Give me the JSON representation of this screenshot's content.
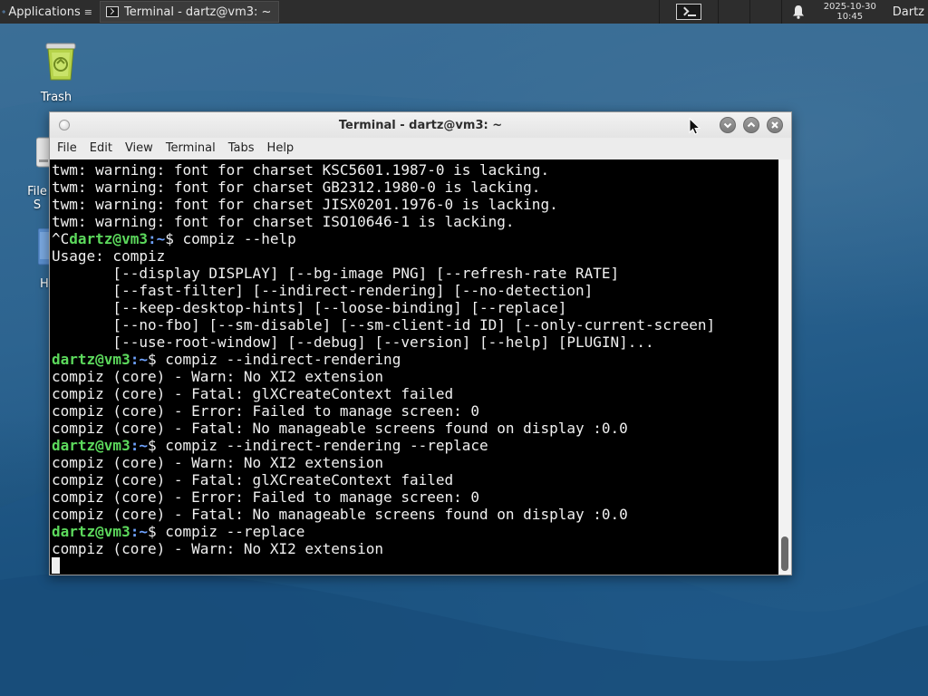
{
  "panel": {
    "applications_label": "Applications",
    "task_label": "Terminal - dartz@vm3: ~",
    "clock_date": "2025-10-30",
    "clock_time": "10:45",
    "user": "Dartz"
  },
  "desktop": {
    "trash_label": "Trash",
    "file_label": "File S",
    "home_label": "H"
  },
  "window": {
    "title": "Terminal - dartz@vm3: ~",
    "menu": [
      "File",
      "Edit",
      "View",
      "Terminal",
      "Tabs",
      "Help"
    ]
  },
  "terminal": {
    "prompt_user": "dartz@vm3",
    "prompt_path": ":~",
    "prompt_symbol": "$ ",
    "lines": [
      {
        "type": "out",
        "text": "twm: warning: font for charset KSC5601.1987-0 is lacking."
      },
      {
        "type": "out",
        "text": "twm: warning: font for charset GB2312.1980-0 is lacking."
      },
      {
        "type": "out",
        "text": "twm: warning: font for charset JISX0201.1976-0 is lacking."
      },
      {
        "type": "out",
        "text": "twm: warning: font for charset ISO10646-1 is lacking."
      },
      {
        "type": "cmd",
        "pre": "^C",
        "cmd": "compiz --help"
      },
      {
        "type": "out",
        "text": "Usage: compiz"
      },
      {
        "type": "out",
        "text": "       [--display DISPLAY] [--bg-image PNG] [--refresh-rate RATE]"
      },
      {
        "type": "out",
        "text": "       [--fast-filter] [--indirect-rendering] [--no-detection]"
      },
      {
        "type": "out",
        "text": "       [--keep-desktop-hints] [--loose-binding] [--replace]"
      },
      {
        "type": "out",
        "text": "       [--no-fbo] [--sm-disable] [--sm-client-id ID] [--only-current-screen]"
      },
      {
        "type": "out",
        "text": "       [--use-root-window] [--debug] [--version] [--help] [PLUGIN]..."
      },
      {
        "type": "cmd",
        "pre": "",
        "cmd": "compiz --indirect-rendering"
      },
      {
        "type": "out",
        "text": "compiz (core) - Warn: No XI2 extension"
      },
      {
        "type": "out",
        "text": "compiz (core) - Fatal: glXCreateContext failed"
      },
      {
        "type": "out",
        "text": "compiz (core) - Error: Failed to manage screen: 0"
      },
      {
        "type": "out",
        "text": "compiz (core) - Fatal: No manageable screens found on display :0.0"
      },
      {
        "type": "cmd",
        "pre": "",
        "cmd": "compiz --indirect-rendering --replace"
      },
      {
        "type": "out",
        "text": "compiz (core) - Warn: No XI2 extension"
      },
      {
        "type": "out",
        "text": "compiz (core) - Fatal: glXCreateContext failed"
      },
      {
        "type": "out",
        "text": "compiz (core) - Error: Failed to manage screen: 0"
      },
      {
        "type": "out",
        "text": "compiz (core) - Fatal: No manageable screens found on display :0.0"
      },
      {
        "type": "cmd",
        "pre": "",
        "cmd": "compiz --replace"
      },
      {
        "type": "out",
        "text": "compiz (core) - Warn: No XI2 extension"
      },
      {
        "type": "cursor"
      }
    ]
  },
  "colors": {
    "prompt_user": "#5cd95c",
    "prompt_path": "#6fa3ff",
    "terminal_bg": "#000000",
    "panel_bg": "#2d2d2d"
  },
  "icons": [
    "applications-icon",
    "terminal-icon",
    "notification-bell-icon",
    "trash-icon",
    "file-system-icon",
    "home-icon",
    "window-menu-icon",
    "minimize-icon",
    "maximize-icon",
    "close-icon",
    "mouse-pointer-icon"
  ]
}
